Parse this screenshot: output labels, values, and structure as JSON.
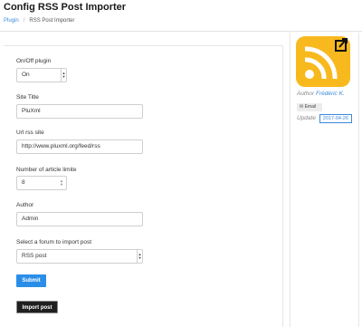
{
  "header": {
    "title": "Config RSS Post Importer"
  },
  "breadcrumb": {
    "items": [
      "Plugin",
      "RSS Post Importer"
    ]
  },
  "form": {
    "onoff": {
      "label": "On/Off plugin",
      "value": "On"
    },
    "site_title": {
      "label": "Site Title",
      "value": "PluXml"
    },
    "url": {
      "label": "Url rss site",
      "value": "http://www.pluxml.org/feed/rss"
    },
    "article_limit": {
      "label": "Number of article limite",
      "value": "8"
    },
    "author": {
      "label": "Author",
      "value": "Admin"
    },
    "forum": {
      "label": "Select a forum to import post",
      "value": "RSS post"
    },
    "submit_label": "Submit",
    "import_label": "Import post"
  },
  "sidebar": {
    "author_prefix": "Author",
    "author_name": "Frédéric K.",
    "email_label": "Email",
    "update_prefix": "Update",
    "update_date": "2017-04-26"
  },
  "colors": {
    "accent": "#2a8ee8",
    "icon_bg": "#f8b91e",
    "dark_button": "#1f1f1f"
  }
}
